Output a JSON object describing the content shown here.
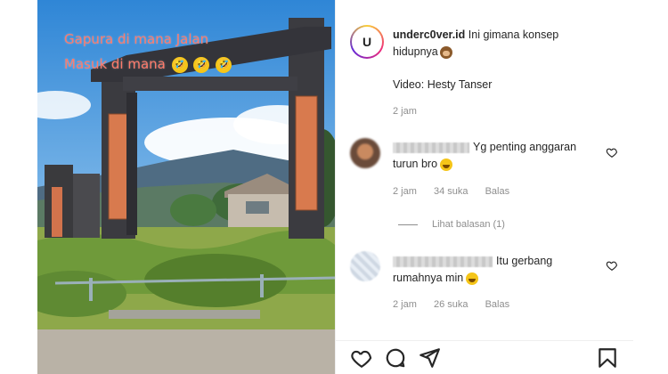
{
  "media": {
    "overlay_line1": "Gapura di mana Jalan",
    "overlay_line2": "Masuk di mana",
    "overlay_emojis": [
      "🤣",
      "🤣",
      "🤣"
    ]
  },
  "post": {
    "username": "underc0ver.id",
    "caption_line1": "Ini gimana konsep",
    "caption_line2": "hidupnya",
    "caption_emoji": "🙈",
    "credit": "Video: Hesty Tanser",
    "time": "2 jam"
  },
  "comments": [
    {
      "text_line1": "Yg penting anggaran",
      "text_line2": "turun bro",
      "emoji": "😆",
      "time": "2 jam",
      "likes": "34 suka",
      "reply": "Balas",
      "view_replies": "Lihat balasan (1)"
    },
    {
      "text_line1": "Itu gerbang",
      "text_line2": "rumahnya min",
      "emoji": "😆",
      "time": "2 jam",
      "likes": "26 suka",
      "reply": "Balas"
    }
  ],
  "actions": {
    "icons": [
      "heart-icon",
      "comment-icon",
      "share-icon",
      "bookmark-icon"
    ]
  },
  "colors": {
    "overlay_text": "#ff7a6a",
    "text": "#262626",
    "meta": "#8e8e8e"
  }
}
